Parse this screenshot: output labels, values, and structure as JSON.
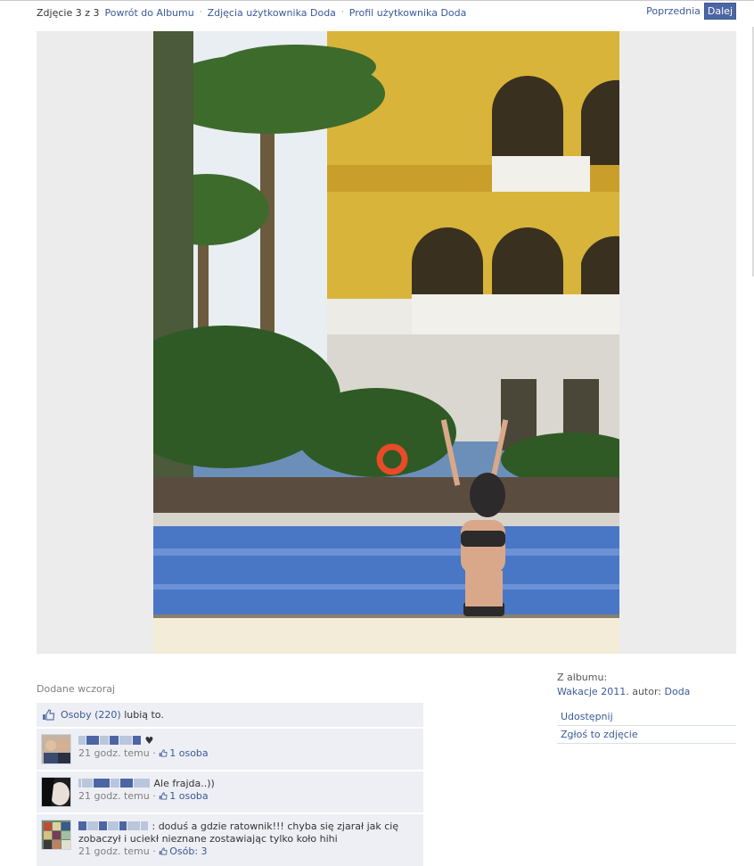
{
  "nav": {
    "counter": "Zdjęcie 3 z 3",
    "back_album": "Powrót do Albumu",
    "user_photos": "Zdjęcia użytkownika Doda",
    "user_profile": "Profil użytkownika Doda",
    "separator": "·"
  },
  "pager": {
    "prev": "Poprzednia",
    "next": "Dalej"
  },
  "photo": {
    "description": "resort pool photo"
  },
  "added": "Dodane wczoraj",
  "likes": {
    "count_link": "Osoby (220)",
    "suffix": "lubią to."
  },
  "comments": [
    {
      "text": "♥",
      "time": "21 godz. temu",
      "likes": "1 osoba"
    },
    {
      "text": "Ale frajda..))",
      "time": "21 godz. temu",
      "likes": "1 osoba"
    },
    {
      "text": ": doduś a gdzie ratownik!!! chyba się zjarał jak cię zobaczył i uciekł nieznane zostawiając tylko koło hihi",
      "time": "21 godz. temu",
      "likes": "Osób: 3"
    }
  ],
  "sidebar": {
    "from_label": "Z albumu:",
    "album_name": "Wakacje 2011.",
    "author_label": "autor:",
    "author_name": "Doda",
    "share": "Udostępnij",
    "report": "Zgłoś to zdjęcie"
  },
  "colors": {
    "link": "#3b5998",
    "panel": "#edeff4",
    "button": "#4c66a4"
  }
}
